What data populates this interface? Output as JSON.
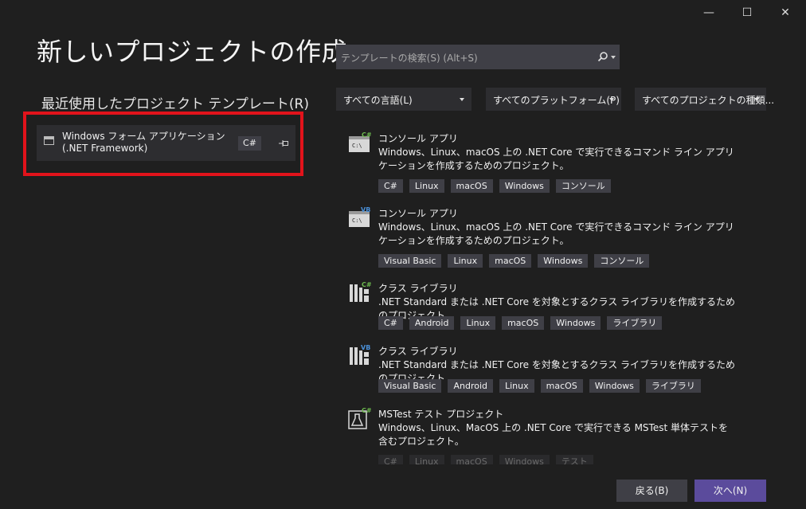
{
  "window": {
    "minimize_glyph": "—",
    "maximize_glyph": "☐",
    "close_glyph": "✕"
  },
  "page_title": "新しいプロジェクトの作成",
  "recent": {
    "heading": "最近使用したプロジェクト テンプレート(R)",
    "items": [
      {
        "name": "Windows フォーム アプリケーション (.NET Framework)",
        "language": "C#"
      }
    ]
  },
  "search": {
    "placeholder": "テンプレートの検索(S) (Alt+S)"
  },
  "filters": {
    "language": "すべての言語(L)",
    "platform": "すべてのプラットフォーム(P)",
    "project_type": "すべてのプロジェクトの種類..."
  },
  "templates": [
    {
      "name": "コンソール アプリ",
      "lang_badge": "C#",
      "icon": "console-app-icon",
      "description": "Windows、Linux、macOS 上の .NET Core で実行できるコマンド ライン アプリケーションを作成するためのプロジェクト。",
      "tags": [
        "C#",
        "Linux",
        "macOS",
        "Windows",
        "コンソール"
      ]
    },
    {
      "name": "コンソール アプリ",
      "lang_badge": "VB",
      "icon": "console-app-icon",
      "description": "Windows、Linux、macOS 上の .NET Core で実行できるコマンド ライン アプリケーションを作成するためのプロジェクト。",
      "tags": [
        "Visual Basic",
        "Linux",
        "macOS",
        "Windows",
        "コンソール"
      ]
    },
    {
      "name": "クラス ライブラリ",
      "lang_badge": "C#",
      "icon": "class-library-icon",
      "description": ".NET Standard または .NET Core を対象とするクラス ライブラリを作成するためのプロジェクト",
      "tags": [
        "C#",
        "Android",
        "Linux",
        "macOS",
        "Windows",
        "ライブラリ"
      ]
    },
    {
      "name": "クラス ライブラリ",
      "lang_badge": "VB",
      "icon": "class-library-icon",
      "description": ".NET Standard または .NET Core を対象とするクラス ライブラリを作成するためのプロジェクト",
      "tags": [
        "Visual Basic",
        "Android",
        "Linux",
        "macOS",
        "Windows",
        "ライブラリ"
      ]
    },
    {
      "name": "MSTest テスト プロジェクト",
      "lang_badge": "C#",
      "icon": "test-flask-icon",
      "description": "Windows、Linux、MacOS 上の .NET Core で実行できる MSTest 単体テストを含むプロジェクト。",
      "tags": [
        "C#",
        "Linux",
        "macOS",
        "Windows",
        "テスト"
      ]
    }
  ],
  "buttons": {
    "back": "戻る(B)",
    "next": "次へ(N)"
  },
  "colors": {
    "highlight": "#e2131b",
    "accent": "#5b4b9c",
    "csharp": "#6dbb4e",
    "vb": "#4a90d9"
  }
}
